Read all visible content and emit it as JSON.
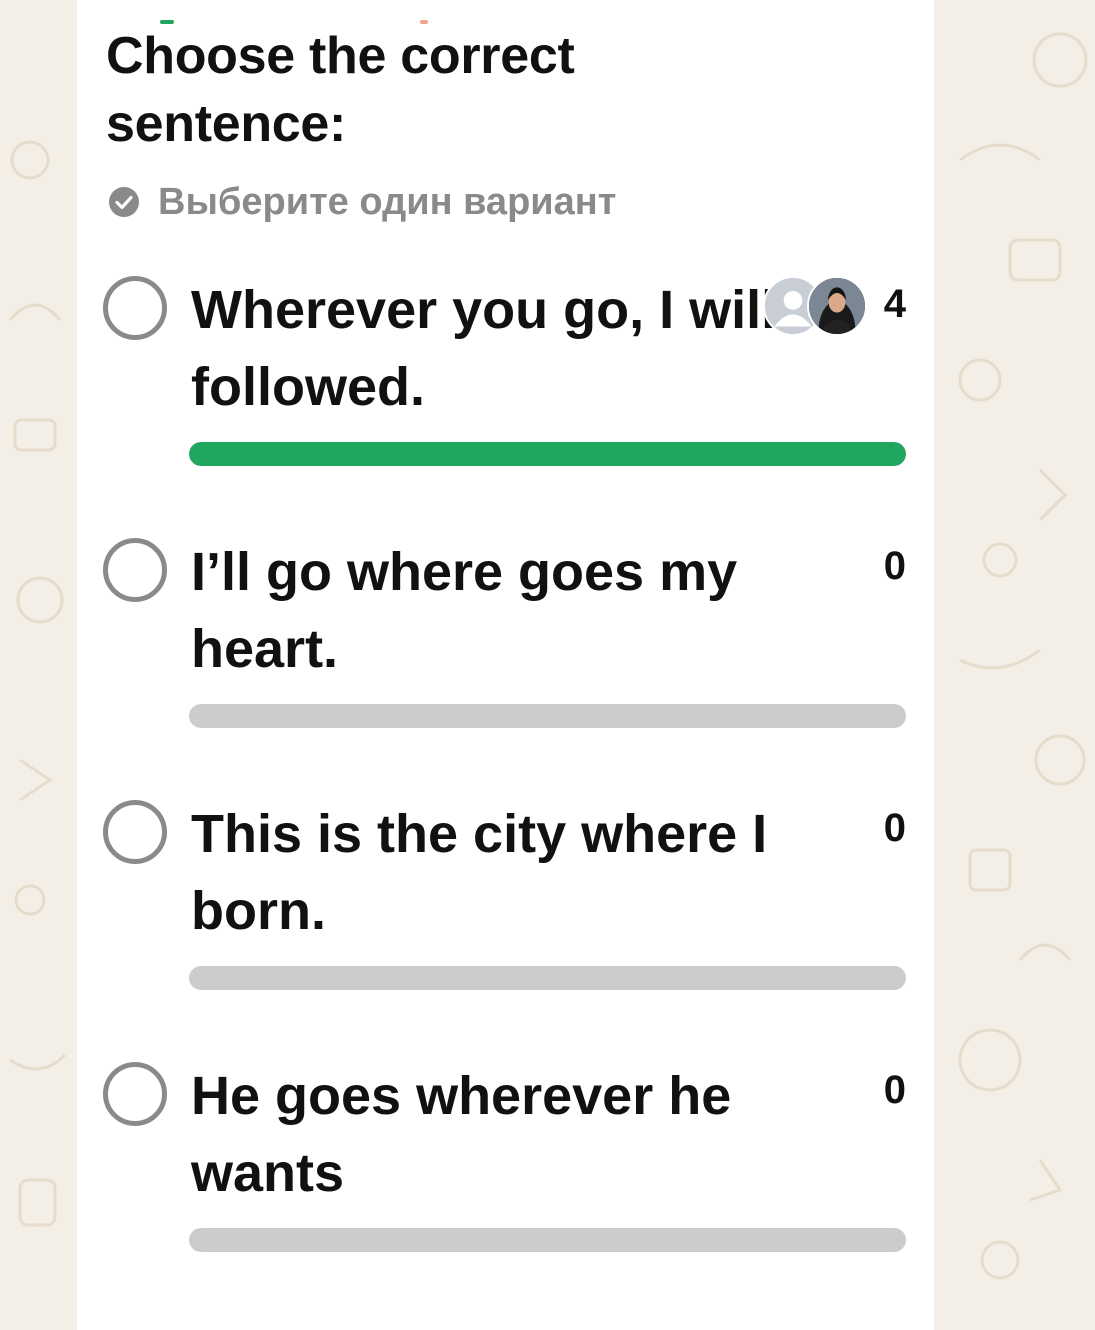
{
  "poll": {
    "question": "Choose the correct sentence:",
    "hint": "Выберите один вариант",
    "accent_color": "#21a660",
    "options": [
      {
        "text": "Wherever you go, I will followed.",
        "votes": "4",
        "share": 1.0
      },
      {
        "text": "I’ll go where goes my heart.",
        "votes": "0",
        "share": 0
      },
      {
        "text": "This is the city where I born.",
        "votes": "0",
        "share": 0
      },
      {
        "text": "He goes wherever he wants",
        "votes": "0",
        "share": 0
      }
    ]
  },
  "icons": {
    "hint": "check-circle-icon",
    "radio": "radio-unchecked-icon",
    "voter_1": "default-avatar-icon",
    "voter_2": "user-photo-avatar"
  }
}
